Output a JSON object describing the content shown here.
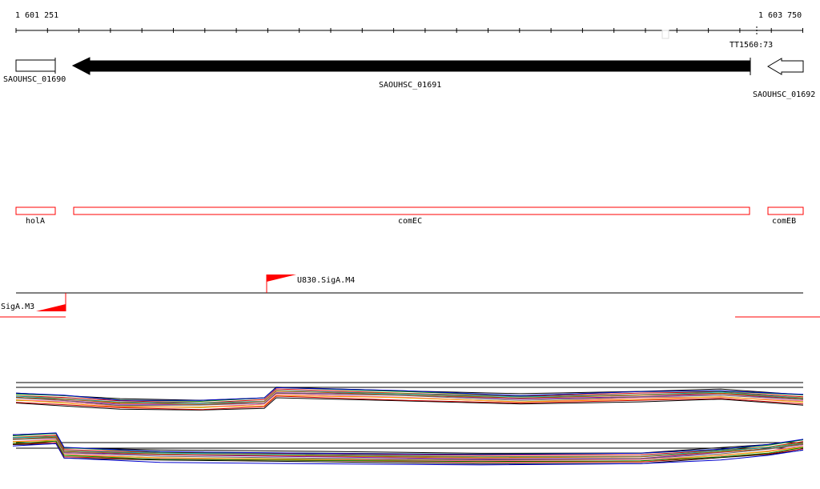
{
  "ruler": {
    "start_label": "1 601 251",
    "end_label": "1 603 750"
  },
  "terminator": {
    "label": "TT1560:73"
  },
  "genes": [
    {
      "label": "SAOUHSC_01690",
      "strand": "forward",
      "fill": "#ffffff"
    },
    {
      "label": "SAOUHSC_01691",
      "strand": "reverse",
      "fill": "#000000"
    },
    {
      "label": "SAOUHSC_01692",
      "strand": "reverse",
      "fill": "#ffffff"
    }
  ],
  "gene_names": [
    {
      "label": "holA"
    },
    {
      "label": "comEC"
    },
    {
      "label": "comEB"
    }
  ],
  "promoters": [
    {
      "label": "U830.SigA.M4",
      "strand": "forward"
    },
    {
      "label": "SigA.M3",
      "strand": "reverse"
    }
  ],
  "colors": {
    "gene_name_box": "#ff0000",
    "promoter_flag": "#ff0000",
    "track_line": "#000000",
    "expression_palette": [
      "#000000",
      "#cc0000",
      "#008800",
      "#0000cc",
      "#cc8800",
      "#8800aa",
      "#00aaaa",
      "#aa5500",
      "#88aa00",
      "#ff66aa",
      "#666666",
      "#ff9900"
    ]
  }
}
